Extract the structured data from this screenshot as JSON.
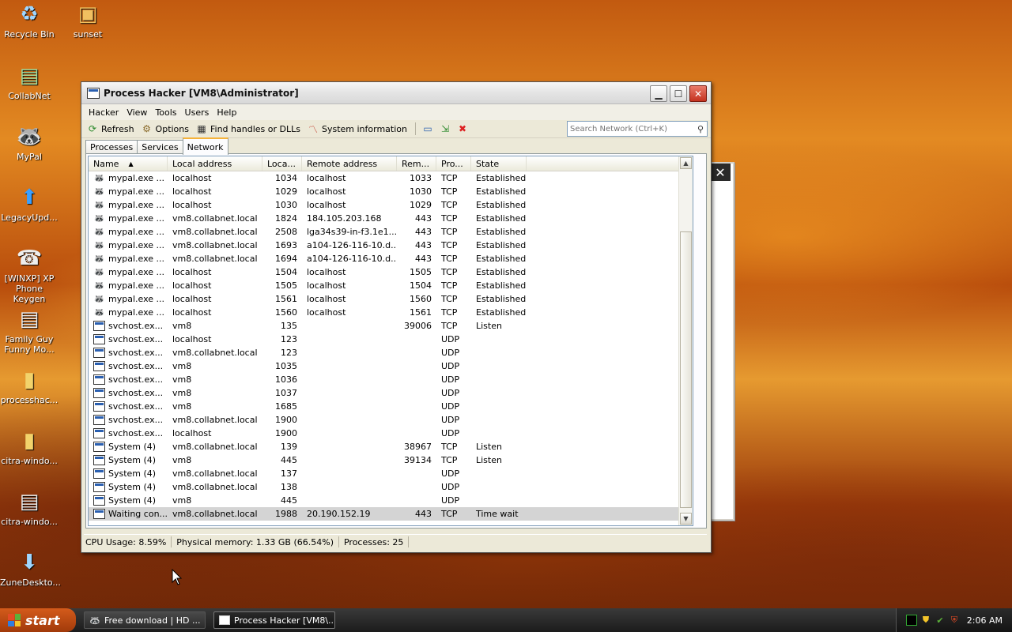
{
  "desktop": {
    "icons": [
      {
        "label": "Recycle Bin",
        "icon": "recycle-bin-icon"
      },
      {
        "label": "sunset",
        "icon": "image-file-icon"
      },
      {
        "label": "CollabNet",
        "icon": "collabnet-icon"
      },
      {
        "label": "MyPal",
        "icon": "mypal-icon"
      },
      {
        "label": "LegacyUpd...",
        "icon": "legacy-update-icon"
      },
      {
        "label": "[WINXP] XP Phone Keygen",
        "icon": "phone-icon"
      },
      {
        "label": "Family Guy Funny Mo...",
        "icon": "video-file-icon"
      },
      {
        "label": "processhac...",
        "icon": "zip-folder-icon"
      },
      {
        "label": "citra-windo...",
        "icon": "zip-folder-icon"
      },
      {
        "label": "citra-windo...",
        "icon": "archive-file-icon"
      },
      {
        "label": "ZuneDeskto...",
        "icon": "installer-icon"
      }
    ]
  },
  "window": {
    "title": "Process Hacker [VM8\\Administrator]",
    "menu": [
      "Hacker",
      "View",
      "Tools",
      "Users",
      "Help"
    ],
    "toolbar": {
      "refresh": "Refresh",
      "options": "Options",
      "find": "Find handles or DLLs",
      "sysinfo": "System information"
    },
    "search_placeholder": "Search Network (Ctrl+K)",
    "tabs": [
      "Processes",
      "Services",
      "Network"
    ],
    "active_tab": "Network",
    "columns": [
      "Name",
      "Local address",
      "Loca...",
      "Remote address",
      "Rem...",
      "Pro...",
      "State"
    ],
    "rows": [
      {
        "icon": "raccoon",
        "name": "mypal.exe ...",
        "laddr": "localhost",
        "lport": "1034",
        "raddr": "localhost",
        "rport": "1033",
        "proto": "TCP",
        "state": "Established"
      },
      {
        "icon": "raccoon",
        "name": "mypal.exe ...",
        "laddr": "localhost",
        "lport": "1029",
        "raddr": "localhost",
        "rport": "1030",
        "proto": "TCP",
        "state": "Established"
      },
      {
        "icon": "raccoon",
        "name": "mypal.exe ...",
        "laddr": "localhost",
        "lport": "1030",
        "raddr": "localhost",
        "rport": "1029",
        "proto": "TCP",
        "state": "Established"
      },
      {
        "icon": "raccoon",
        "name": "mypal.exe ...",
        "laddr": "vm8.collabnet.local",
        "lport": "1824",
        "raddr": "184.105.203.168",
        "rport": "443",
        "proto": "TCP",
        "state": "Established"
      },
      {
        "icon": "raccoon",
        "name": "mypal.exe ...",
        "laddr": "vm8.collabnet.local",
        "lport": "2508",
        "raddr": "lga34s39-in-f3.1e1...",
        "rport": "443",
        "proto": "TCP",
        "state": "Established"
      },
      {
        "icon": "raccoon",
        "name": "mypal.exe ...",
        "laddr": "vm8.collabnet.local",
        "lport": "1693",
        "raddr": "a104-126-116-10.d...",
        "rport": "443",
        "proto": "TCP",
        "state": "Established"
      },
      {
        "icon": "raccoon",
        "name": "mypal.exe ...",
        "laddr": "vm8.collabnet.local",
        "lport": "1694",
        "raddr": "a104-126-116-10.d...",
        "rport": "443",
        "proto": "TCP",
        "state": "Established"
      },
      {
        "icon": "raccoon",
        "name": "mypal.exe ...",
        "laddr": "localhost",
        "lport": "1504",
        "raddr": "localhost",
        "rport": "1505",
        "proto": "TCP",
        "state": "Established"
      },
      {
        "icon": "raccoon",
        "name": "mypal.exe ...",
        "laddr": "localhost",
        "lport": "1505",
        "raddr": "localhost",
        "rport": "1504",
        "proto": "TCP",
        "state": "Established"
      },
      {
        "icon": "raccoon",
        "name": "mypal.exe ...",
        "laddr": "localhost",
        "lport": "1561",
        "raddr": "localhost",
        "rport": "1560",
        "proto": "TCP",
        "state": "Established"
      },
      {
        "icon": "raccoon",
        "name": "mypal.exe ...",
        "laddr": "localhost",
        "lport": "1560",
        "raddr": "localhost",
        "rport": "1561",
        "proto": "TCP",
        "state": "Established"
      },
      {
        "icon": "win",
        "name": "svchost.ex...",
        "laddr": "vm8",
        "lport": "135",
        "raddr": "",
        "rport": "39006",
        "proto": "TCP",
        "state": "Listen"
      },
      {
        "icon": "win",
        "name": "svchost.ex...",
        "laddr": "localhost",
        "lport": "123",
        "raddr": "",
        "rport": "",
        "proto": "UDP",
        "state": ""
      },
      {
        "icon": "win",
        "name": "svchost.ex...",
        "laddr": "vm8.collabnet.local",
        "lport": "123",
        "raddr": "",
        "rport": "",
        "proto": "UDP",
        "state": ""
      },
      {
        "icon": "win",
        "name": "svchost.ex...",
        "laddr": "vm8",
        "lport": "1035",
        "raddr": "",
        "rport": "",
        "proto": "UDP",
        "state": ""
      },
      {
        "icon": "win",
        "name": "svchost.ex...",
        "laddr": "vm8",
        "lport": "1036",
        "raddr": "",
        "rport": "",
        "proto": "UDP",
        "state": ""
      },
      {
        "icon": "win",
        "name": "svchost.ex...",
        "laddr": "vm8",
        "lport": "1037",
        "raddr": "",
        "rport": "",
        "proto": "UDP",
        "state": ""
      },
      {
        "icon": "win",
        "name": "svchost.ex...",
        "laddr": "vm8",
        "lport": "1685",
        "raddr": "",
        "rport": "",
        "proto": "UDP",
        "state": ""
      },
      {
        "icon": "win",
        "name": "svchost.ex...",
        "laddr": "vm8.collabnet.local",
        "lport": "1900",
        "raddr": "",
        "rport": "",
        "proto": "UDP",
        "state": ""
      },
      {
        "icon": "win",
        "name": "svchost.ex...",
        "laddr": "localhost",
        "lport": "1900",
        "raddr": "",
        "rport": "",
        "proto": "UDP",
        "state": ""
      },
      {
        "icon": "win",
        "name": "System (4)",
        "laddr": "vm8.collabnet.local",
        "lport": "139",
        "raddr": "",
        "rport": "38967",
        "proto": "TCP",
        "state": "Listen"
      },
      {
        "icon": "win",
        "name": "System (4)",
        "laddr": "vm8",
        "lport": "445",
        "raddr": "",
        "rport": "39134",
        "proto": "TCP",
        "state": "Listen"
      },
      {
        "icon": "win",
        "name": "System (4)",
        "laddr": "vm8.collabnet.local",
        "lport": "137",
        "raddr": "",
        "rport": "",
        "proto": "UDP",
        "state": ""
      },
      {
        "icon": "win",
        "name": "System (4)",
        "laddr": "vm8.collabnet.local",
        "lport": "138",
        "raddr": "",
        "rport": "",
        "proto": "UDP",
        "state": ""
      },
      {
        "icon": "win",
        "name": "System (4)",
        "laddr": "vm8",
        "lport": "445",
        "raddr": "",
        "rport": "",
        "proto": "UDP",
        "state": ""
      },
      {
        "icon": "win",
        "name": "Waiting con...",
        "laddr": "vm8.collabnet.local",
        "lport": "1988",
        "raddr": "20.190.152.19",
        "rport": "443",
        "proto": "TCP",
        "state": "Time wait",
        "selected": true
      }
    ],
    "status": {
      "cpu": "CPU Usage: 8.59%",
      "memory": "Physical memory: 1.33 GB (66.54%)",
      "processes": "Processes: 25"
    }
  },
  "taskbar": {
    "start": "start",
    "tasks": [
      "Free download | HD ...",
      "Process Hacker [VM8\\..."
    ],
    "clock": "2:06 AM"
  }
}
